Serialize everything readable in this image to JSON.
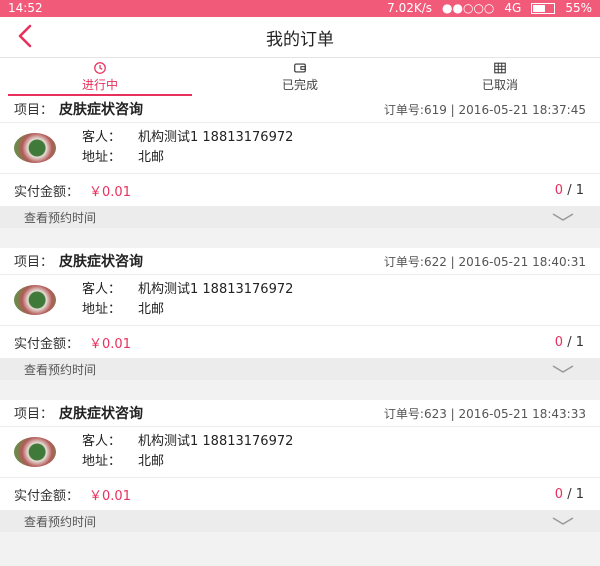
{
  "status": {
    "time": "14:52",
    "speed": "7.02K/s",
    "network": "4G",
    "battery": "55%",
    "battery_level": 0.55
  },
  "header": {
    "title": "我的订单"
  },
  "tabs": [
    {
      "label": "进行中",
      "icon": "clock-icon",
      "active": true
    },
    {
      "label": "已完成",
      "icon": "wallet-icon"
    },
    {
      "label": "已取消",
      "icon": "list-icon"
    }
  ],
  "labels": {
    "project": "项目：",
    "guest": "客人：",
    "address": "地址：",
    "paid": "实付金额：",
    "view_time": "查看预约时间"
  },
  "orders": [
    {
      "project": "皮肤症状咨询",
      "meta": "订单号:619 | 2016-05-21 18:37:45",
      "guest": "机构测试1 18813176972",
      "address": "北邮",
      "amount": "￥0.01",
      "count_done": "0",
      "count_total": "/ 1"
    },
    {
      "project": "皮肤症状咨询",
      "meta": "订单号:622 | 2016-05-21 18:40:31",
      "guest": "机构测试1 18813176972",
      "address": "北邮",
      "amount": "￥0.01",
      "count_done": "0",
      "count_total": "/ 1"
    },
    {
      "project": "皮肤症状咨询",
      "meta": "订单号:623 | 2016-05-21 18:43:33",
      "guest": "机构测试1 18813176972",
      "address": "北邮",
      "amount": "￥0.01",
      "count_done": "0",
      "count_total": "/ 1"
    }
  ],
  "colors": {
    "accent": "#e8305c",
    "statusbar": "#f25a7a"
  }
}
